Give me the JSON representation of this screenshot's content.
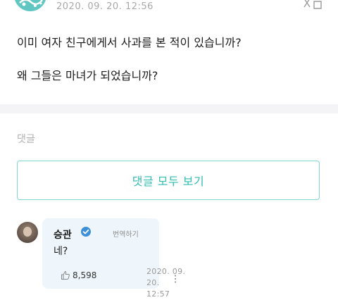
{
  "post": {
    "date": "2020. 09. 20. 12:56",
    "lines": [
      "이미 여자 친구에게서 사과를 본 적이 있습니까?",
      "왜 그들은 마녀가 되었습니까?"
    ]
  },
  "comments_section": {
    "label": "댓글",
    "view_all_label": "댓글 모두 보기"
  },
  "comment": {
    "author": "승관",
    "translate_label": "번역하기",
    "text": "네?",
    "like_count": "8,598",
    "time_line1": "2020. 09. 20.",
    "time_line2": "12:57"
  },
  "icons": {
    "translate": "translate-icon",
    "verified": "verified-badge-icon",
    "like": "thumbs-up-icon",
    "more": "more-vertical-icon"
  },
  "colors": {
    "accent": "#2fbdb0",
    "accent_border": "#7ed6ce",
    "bubble": "#eef6fb",
    "verified": "#3d8fd8"
  }
}
